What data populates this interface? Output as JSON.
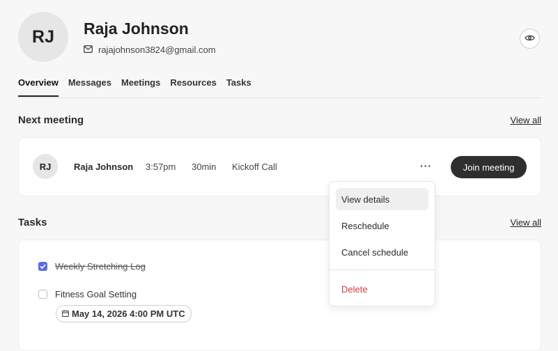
{
  "profile": {
    "initials": "RJ",
    "name": "Raja Johnson",
    "email": "rajajohnson3824@gmail.com"
  },
  "tabs": [
    {
      "label": "Overview",
      "active": true
    },
    {
      "label": "Messages",
      "active": false
    },
    {
      "label": "Meetings",
      "active": false
    },
    {
      "label": "Resources",
      "active": false
    },
    {
      "label": "Tasks",
      "active": false
    }
  ],
  "next_meeting": {
    "section_title": "Next meeting",
    "view_all": "View all",
    "initials": "RJ",
    "name": "Raja Johnson",
    "time": "3:57pm",
    "duration": "30min",
    "title": "Kickoff Call",
    "more_label": "···",
    "join_label": "Join meeting"
  },
  "menu": {
    "items": [
      "View details",
      "Reschedule",
      "Cancel schedule"
    ],
    "delete_label": "Delete"
  },
  "tasks": {
    "section_title": "Tasks",
    "view_all": "View all",
    "items": [
      {
        "label": "Weekly Stretching Log",
        "checked": true
      },
      {
        "label": "Fitness Goal Setting",
        "checked": false
      }
    ],
    "due_date": "May 14, 2026 4:00 PM UTC"
  },
  "colors": {
    "accent": "#5b6ee1",
    "button_dark": "#2f2f2f",
    "danger": "#d13b3b",
    "background": "#f7f7f7"
  }
}
